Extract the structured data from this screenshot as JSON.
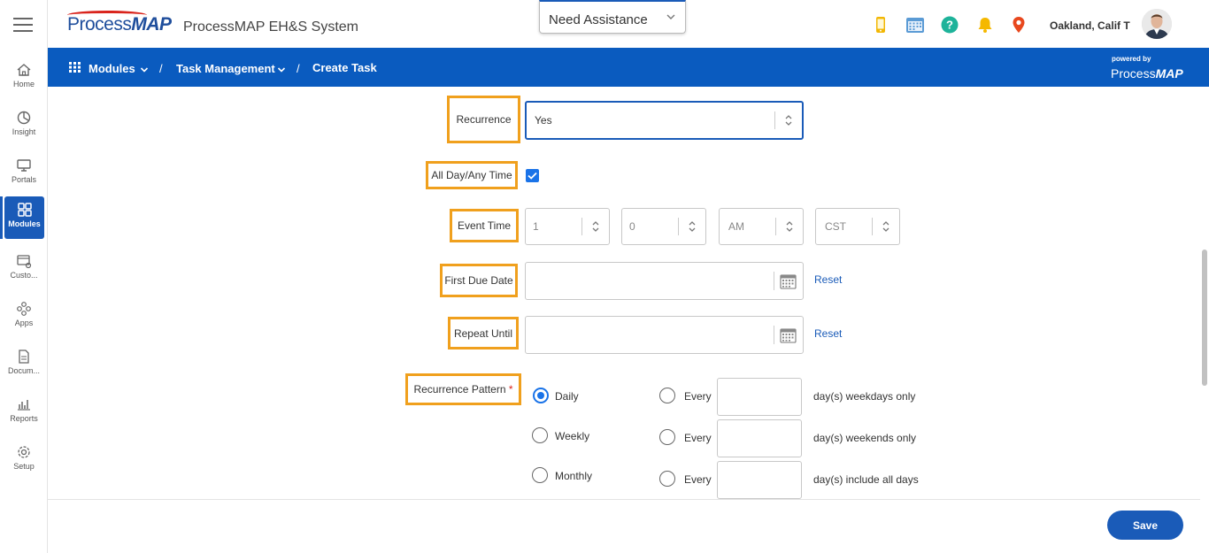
{
  "rail": {
    "items": [
      {
        "label": "Home"
      },
      {
        "label": "Insight"
      },
      {
        "label": "Portals"
      },
      {
        "label": "Modules"
      },
      {
        "label": "Custo..."
      },
      {
        "label": "Apps"
      },
      {
        "label": "Docum..."
      },
      {
        "label": "Reports"
      },
      {
        "label": "Setup"
      }
    ]
  },
  "header": {
    "logo_pre": "Process",
    "logo_bold": "MAP",
    "app_title": "ProcessMAP EH&S System",
    "assistance": "Need Assistance",
    "user_name": "Oakland, Calif T"
  },
  "breadcrumb": {
    "modules": "Modules",
    "sep": "/",
    "task_mgmt": "Task Management",
    "current": "Create Task",
    "powered_by": "powered by",
    "powered_pre": "Process",
    "powered_bold": "MAP"
  },
  "form": {
    "recurrence_label": "Recurrence",
    "recurrence_value": "Yes",
    "allday_label": "All Day/Any Time",
    "event_time_label": "Event Time",
    "event_hour": "1",
    "event_minute": "0",
    "event_ampm": "AM",
    "event_tz": "CST",
    "first_due_label": "First Due Date",
    "repeat_until_label": "Repeat Until",
    "reset_label": "Reset",
    "pattern_label": "Recurrence Pattern",
    "required_mark": "*",
    "patterns": [
      "Daily",
      "Weekly",
      "Monthly"
    ],
    "every_label": "Every",
    "options": [
      "day(s) weekdays only",
      "day(s) weekends only",
      "day(s) include all days"
    ]
  },
  "footer": {
    "save_label": "Save"
  },
  "colors": {
    "brand_blue": "#0a5bbf",
    "highlight": "#f0a01d",
    "accent": "#1a73e8"
  }
}
